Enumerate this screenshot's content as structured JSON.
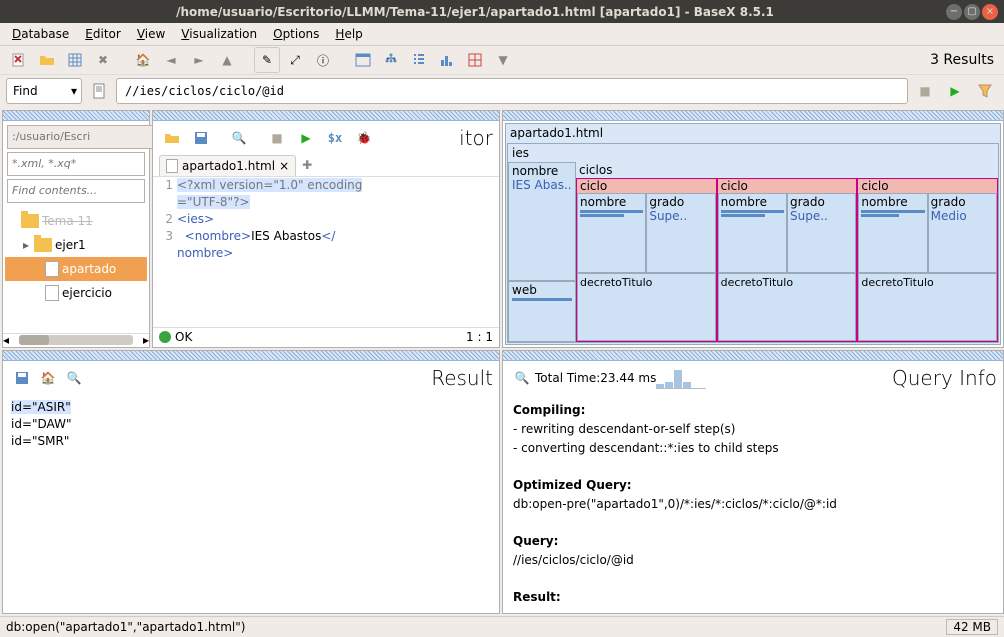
{
  "window": {
    "title": "/home/usuario/Escritorio/LLMM/Tema-11/ejer1/apartado1.html [apartado1] - BaseX 8.5.1"
  },
  "menu": {
    "database": "Database",
    "editor": "Editor",
    "view": "View",
    "visualization": "Visualization",
    "options": "Options",
    "help": "Help"
  },
  "results_count": "3 Results",
  "search": {
    "mode": "Find",
    "xpath": "//ies/ciclos/ciclo/@id"
  },
  "nav": {
    "path_placeholder": ":/usuario/Escri",
    "filter_placeholder": "*.xml, *.xq*",
    "find_placeholder": "Find contents...",
    "items": [
      {
        "type": "folder",
        "label": "ejer1",
        "expandable": true,
        "indent": 1
      },
      {
        "type": "file",
        "label": "apartado",
        "indent": 2,
        "sel": true
      },
      {
        "type": "file",
        "label": "ejercicio",
        "indent": 2
      }
    ]
  },
  "editor": {
    "label": "itor",
    "tab": "apartado1.html",
    "lines": [
      "<?xml version=\"1.0\" encoding=\"UTF-8\"?>",
      "<ies>",
      "  <nombre>IES Abastos</nombre>"
    ],
    "status": "OK",
    "pos": "1 : 1"
  },
  "treemap": {
    "root": "apartado1.html",
    "ies": "ies",
    "nombre": "nombre",
    "nombre_val": "IES Abas..",
    "web": "web",
    "ciclos": "ciclos",
    "ciclo": "ciclo",
    "nombre_h": "nombre",
    "grado_h": "grado",
    "grados": [
      "Supe..",
      "Supe..",
      "Medio"
    ],
    "decreto": "decretoTitulo"
  },
  "result": {
    "heading": "Result",
    "lines": [
      "id=\"ASIR\"",
      "id=\"DAW\"",
      "id=\"SMR\""
    ]
  },
  "qinfo": {
    "heading": "Query Info",
    "time_label": "Total Time: ",
    "time": "23.44 ms",
    "compiling": "Compiling:",
    "c1": "- rewriting descendant-or-self step(s)",
    "c2": "- converting descendant::*:ies to child steps",
    "opt_label": "Optimized Query:",
    "opt": "db:open-pre(\"apartado1\",0)/*:ies/*:ciclos/*:ciclo/@*:id",
    "q_label": "Query:",
    "q": "//ies/ciclos/ciclo/@id",
    "r_label": "Result:"
  },
  "statusbar": {
    "text": "db:open(\"apartado1\",\"apartado1.html\")",
    "mem": "42 MB"
  }
}
